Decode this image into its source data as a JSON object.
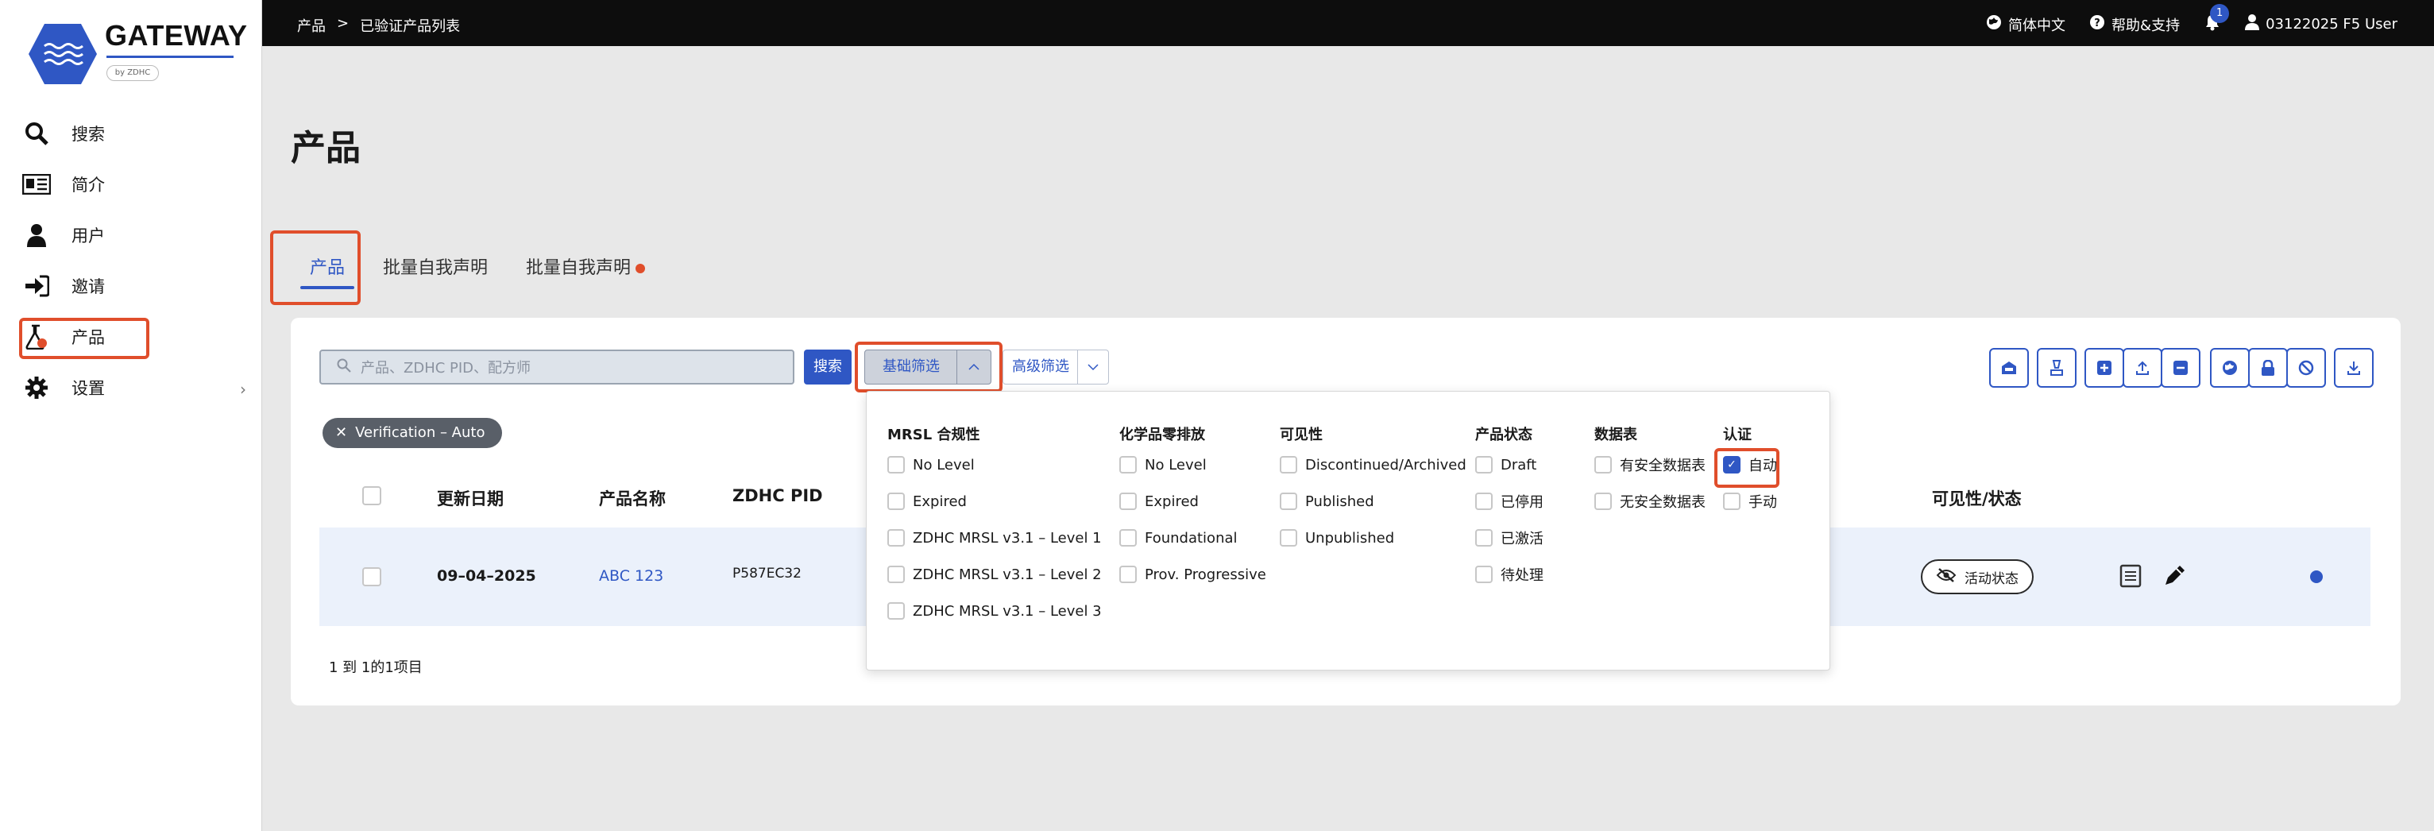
{
  "brand": {
    "name": "GATEWAY",
    "sub": "by ZDHC"
  },
  "sidebar": {
    "items": [
      {
        "label": "搜索",
        "icon": "search-icon"
      },
      {
        "label": "简介",
        "icon": "profile-card-icon"
      },
      {
        "label": "用户",
        "icon": "user-icon"
      },
      {
        "label": "邀请",
        "icon": "sign-in-icon"
      },
      {
        "label": "产品",
        "icon": "flask-icon"
      },
      {
        "label": "设置",
        "icon": "gear-icon"
      }
    ]
  },
  "topbar": {
    "breadcrumb": [
      "产品",
      ">",
      "已验证产品列表"
    ],
    "language": "简体中文",
    "help": "帮助&支持",
    "notifications": "1",
    "user": "03122025 F5 User"
  },
  "page": {
    "title": "产品"
  },
  "tabs": [
    {
      "label": "产品",
      "active": true
    },
    {
      "label": "批量自我声明",
      "active": false
    },
    {
      "label": "批量自我声明",
      "active": false,
      "dot": true
    }
  ],
  "toolbar": {
    "search_placeholder": "产品、ZDHC PID、配方师",
    "search_button": "搜索",
    "basic_filter": "基础筛选",
    "advanced_filter": "高级筛选"
  },
  "active_chip": "Verification – Auto",
  "table": {
    "headers": [
      "更新日期",
      "产品名称",
      "ZDHC PID",
      "可见性/状态"
    ],
    "rows": [
      {
        "date": "09–04–2025",
        "name": "ABC 123",
        "pid": "P587EC32",
        "status": "活动状态"
      }
    ],
    "pager": "1 到 1的1项目"
  },
  "filters": {
    "mrsl": {
      "title": "MRSL 合规性",
      "options": [
        "No Level",
        "Expired",
        "ZDHC MRSL v3.1 – Level 1",
        "ZDHC MRSL v3.1 – Level 2",
        "ZDHC MRSL v3.1 – Level 3"
      ]
    },
    "zde": {
      "title": "化学品零排放",
      "options": [
        "No Level",
        "Expired",
        "Foundational",
        "Prov. Progressive"
      ]
    },
    "visibility": {
      "title": "可见性",
      "options": [
        "Discontinued/Archived",
        "Published",
        "Unpublished"
      ]
    },
    "status": {
      "title": "产品状态",
      "options": [
        "Draft",
        "已停用",
        "已激活",
        "待处理"
      ]
    },
    "sds": {
      "title": "数据表",
      "options": [
        "有安全数据表",
        "无安全数据表"
      ]
    },
    "cert": {
      "title": "认证",
      "options": [
        "自动",
        "手动"
      ],
      "checked": [
        true,
        false
      ]
    }
  },
  "colors": {
    "accent": "#2f57c4",
    "highlight": "#e04e2b",
    "topbar": "#0d0d0d"
  }
}
